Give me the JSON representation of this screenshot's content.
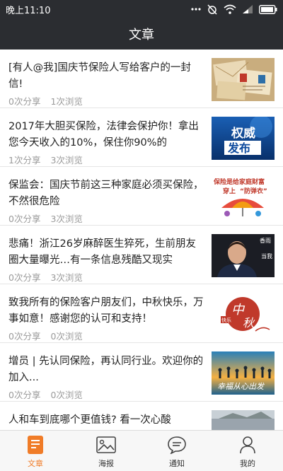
{
  "status_bar": {
    "time": "晚上11:10"
  },
  "header": {
    "title": "文章"
  },
  "articles": [
    {
      "title": "[有人@我]国庆节保险人写给客户的一封信!",
      "shares": "0次分享",
      "views": "1次浏览",
      "thumb": "envelopes-image"
    },
    {
      "title": "2017年大胆买保险，法律会保护你！拿出您今天收入的10%，保住你90%的",
      "shares": "1次分享",
      "views": "3次浏览",
      "thumb": "authority-release-image",
      "thumb_text": [
        "权威",
        "发布"
      ]
    },
    {
      "title": "保监会：国庆节前这三种家庭必须买保险，不然很危险",
      "shares": "0次分享",
      "views": "3次浏览",
      "thumb": "insurance-umbrella-image",
      "thumb_text": [
        "保险是给家庭财富",
        "穿上",
        "“防弹衣”"
      ]
    },
    {
      "title": "悲痛！浙江26岁麻醉医生猝死，生前朋友圈大量曝光…有一条信息残酷又现实",
      "shares": "0次分享",
      "views": "3次浏览",
      "thumb": "man-portrait-image",
      "thumb_text": [
        "香雨",
        "当我"
      ]
    },
    {
      "title": "致我所有的保险客户朋友们，中秋快乐，万事如意！感谢您的认可和支持！",
      "shares": "0次分享",
      "views": "0次浏览",
      "thumb": "mid-autumn-image",
      "thumb_text": [
        "中",
        "秋",
        "快乐"
      ]
    },
    {
      "title": "增员 | 先认同保险，再认同行业。欢迎你的加入...",
      "shares": "0次分享",
      "views": "0次浏览",
      "thumb": "team-sunset-image",
      "thumb_text": [
        "幸福从心出发"
      ]
    },
    {
      "title": "人和车到底哪个更值钱? 看一次心酸",
      "shares": "",
      "views": "",
      "thumb": "car-crash-image"
    }
  ],
  "tabs": [
    {
      "label": "文章",
      "icon": "article-icon",
      "active": true
    },
    {
      "label": "海报",
      "icon": "poster-icon",
      "active": false
    },
    {
      "label": "通知",
      "icon": "notice-icon",
      "active": false
    },
    {
      "label": "我的",
      "icon": "profile-icon",
      "active": false
    }
  ],
  "colors": {
    "header_bg": "#2b2d31",
    "accent": "#f07c28",
    "meta_text": "#9a9a9a"
  }
}
